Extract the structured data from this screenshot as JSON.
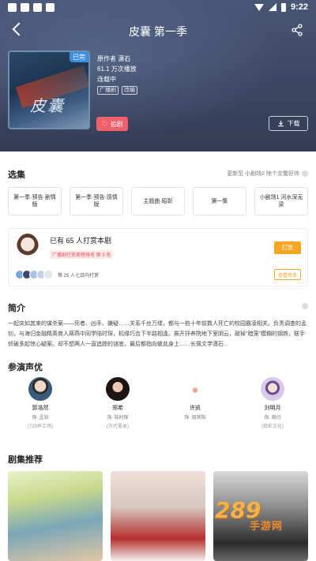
{
  "status": {
    "time": "9:22"
  },
  "header": {
    "title": "皮囊 第一季"
  },
  "cover": {
    "tag": "已完",
    "title": "皮囊"
  },
  "meta": {
    "author": "原作者 潇石",
    "plays": "61.1 万次播放",
    "status": "连载中",
    "tags": [
      "广播剧",
      "改编"
    ]
  },
  "actions": {
    "follow": "追剧",
    "download": "下载"
  },
  "episodes": {
    "title": "选集",
    "update": "更新至 小剧场2 除个交警好帅",
    "items": [
      "第一季·预告·剧情版",
      "第一季·预告·感情版",
      "主题曲·昭彰",
      "第一集",
      "小剧场1 河水深无梁"
    ]
  },
  "reward": {
    "text": "已有 65 人打赏本剧",
    "rank": "广播剧打赏周榜排名 第 9 名",
    "button": "打赏",
    "weekly": "等 25 人七日内打赏",
    "rank_button": "查看榜单"
  },
  "intro": {
    "title": "简介",
    "text": "一起突如其来的谋杀案——死者、凶手、嫌疑……关系千丝万缕，都与一桩十年前数人死亡的校园霸凌相关。负责调查的孟钊，与海归金融精英商人蒋燕中同学陆时琛，机缘巧合下半路相逢。挨开抒养院地下室阴云，敲掉\"暗笼\"模糊的钢铁，联手侦破多起惊心疑案。却不想两人一直追踪的谜底，最后都指向彼此身上……长佩文学潇石..."
  },
  "cast": {
    "title": "参演声优",
    "actors": [
      {
        "name": "郭浩然",
        "role": "饰: 孟钊",
        "studio": "(729声工场)"
      },
      {
        "name": "郑希",
        "role": "饰: 陆时琛",
        "studio": "(万代夏本)"
      },
      {
        "name": "许凯",
        "role": "饰: 周其阳",
        "studio": ""
      },
      {
        "name": "刘明月",
        "role": "饰: 周衍",
        "studio": "(寂彩文化)"
      }
    ]
  },
  "recommend": {
    "title": "剧集推荐"
  },
  "watermark": {
    "num": "289",
    "cn": "手游网"
  }
}
